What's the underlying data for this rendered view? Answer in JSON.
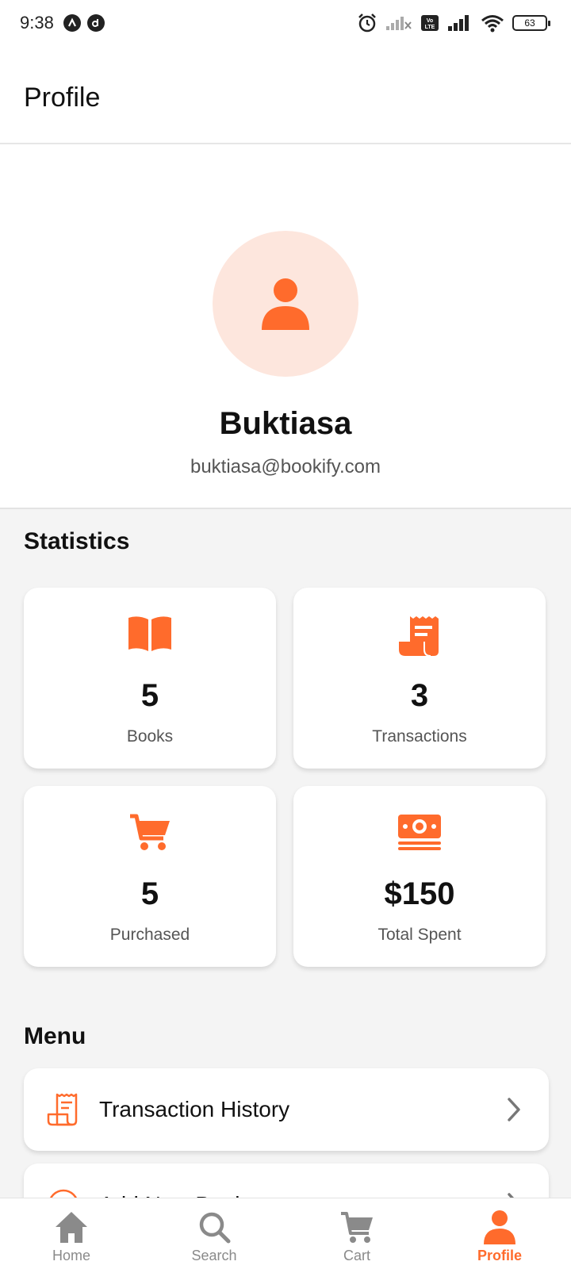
{
  "status_bar": {
    "time": "9:38",
    "left_icons": [
      "n-icon",
      "d-icon"
    ],
    "right_icons": [
      "alarm-icon",
      "signal-off-icon",
      "volte-icon",
      "signal-icon",
      "wifi-icon"
    ],
    "battery": "63"
  },
  "app_bar": {
    "title": "Profile"
  },
  "profile": {
    "avatar_icon": "person-icon",
    "name": "Buktiasa",
    "email": "buktiasa@bookify.com"
  },
  "statistics": {
    "title": "Statistics",
    "cards": [
      {
        "icon": "book-icon",
        "value": "5",
        "label": "Books"
      },
      {
        "icon": "receipt-icon",
        "value": "3",
        "label": "Transactions"
      },
      {
        "icon": "cart-icon",
        "value": "5",
        "label": "Purchased"
      },
      {
        "icon": "money-icon",
        "value": "$150",
        "label": "Total Spent"
      }
    ]
  },
  "menu": {
    "title": "Menu",
    "items": [
      {
        "icon": "receipt-outline-icon",
        "label": "Transaction History"
      },
      {
        "icon": "add-circle-icon",
        "label": "Add New Book"
      }
    ]
  },
  "bottom_nav": {
    "items": [
      {
        "icon": "home-icon",
        "label": "Home"
      },
      {
        "icon": "search-icon",
        "label": "Search"
      },
      {
        "icon": "cart-icon",
        "label": "Cart"
      },
      {
        "icon": "person-icon",
        "label": "Profile"
      }
    ],
    "active": "Profile"
  },
  "colors": {
    "accent": "#ff6b2c",
    "accent_light": "#fde6dd",
    "background": "#f4f4f4",
    "inactive": "#8a8a8a"
  }
}
